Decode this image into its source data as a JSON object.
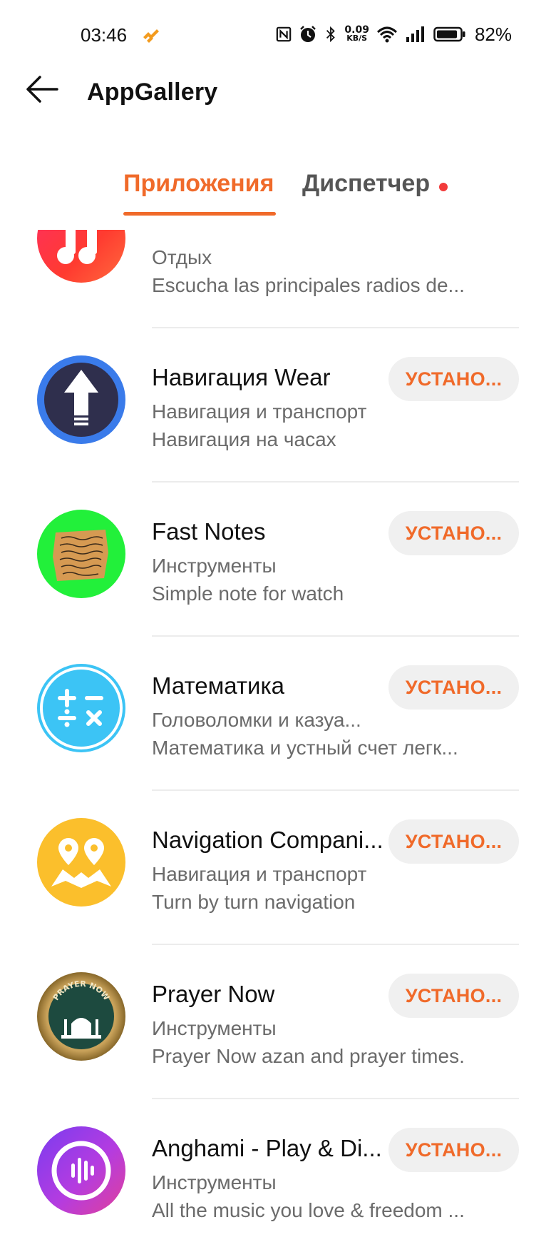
{
  "status_bar": {
    "time": "03:46",
    "net_speed_value": "0.09",
    "net_speed_unit": "KB/S",
    "battery_percent": "82%",
    "icons": [
      "huawei-bolt-icon",
      "nfc-icon",
      "alarm-icon",
      "bluetooth-icon",
      "wifi-icon",
      "cellular-signal-icon",
      "battery-icon"
    ]
  },
  "header": {
    "title": "AppGallery",
    "back_icon": "arrow-left-icon"
  },
  "tabs": [
    {
      "label": "Приложения",
      "active": true
    },
    {
      "label": "Диспетчер",
      "active": false,
      "badge": "red-dot"
    }
  ],
  "colors": {
    "accent": "#f06a2a",
    "badge": "#f23b3b",
    "button_bg": "#f0f0f0"
  },
  "apps": [
    {
      "name": "",
      "category": "Отдых",
      "description": "Escucha las principales radios de...",
      "install_label": "",
      "icon": "music-app-icon"
    },
    {
      "name": "Навигация Wear",
      "category": "Навигация и транспорт",
      "description": "Навигация на часах",
      "install_label": "УСТАНО...",
      "icon": "navigation-arrow-icon"
    },
    {
      "name": "Fast Notes",
      "category": "Инструменты",
      "description": "Simple note for watch",
      "install_label": "УСТАНО...",
      "icon": "notes-paper-icon"
    },
    {
      "name": "Математика",
      "category": "Головоломки и казуа...",
      "description": "Математика и устный счет легк...",
      "install_label": "УСТАНО...",
      "icon": "math-operators-icon"
    },
    {
      "name": "Navigation Compani...",
      "category": "Навигация и транспорт",
      "description": "Turn by turn navigation",
      "install_label": "УСТАНО...",
      "icon": "map-pins-icon"
    },
    {
      "name": "Prayer Now",
      "category": "Инструменты",
      "description": "Prayer Now azan and prayer times.",
      "install_label": "УСТАНО...",
      "icon": "mosque-icon",
      "icon_text": "PRAYER NOW"
    },
    {
      "name": "Anghami - Play & Di...",
      "category": "Инструменты",
      "description": "All the music you love & freedom ...",
      "install_label": "УСТАНО...",
      "icon": "anghami-music-icon"
    }
  ]
}
